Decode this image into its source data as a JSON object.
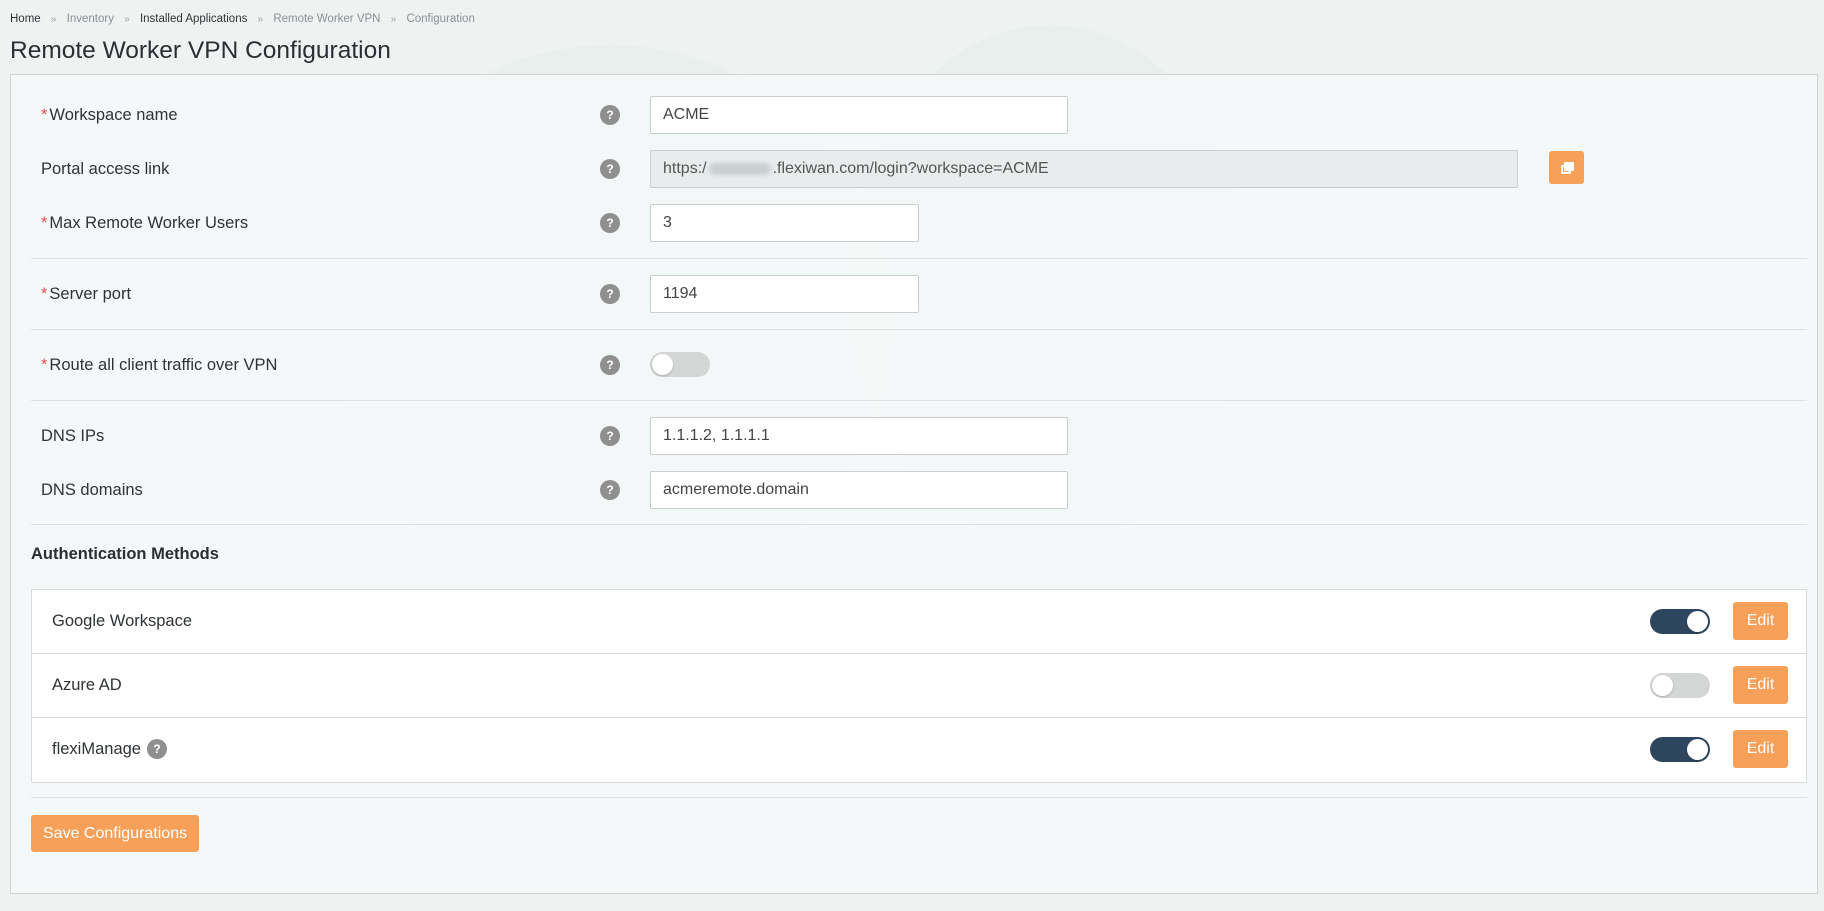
{
  "breadcrumb": {
    "items": [
      "Home",
      "Inventory",
      "Installed Applications",
      "Remote Worker VPN",
      "Configuration"
    ],
    "separator": "»"
  },
  "page": {
    "title": "Remote Worker VPN Configuration"
  },
  "form": {
    "help_glyph": "?",
    "required_mark": "*",
    "workspace_name": {
      "label": "Workspace name",
      "value": "ACME"
    },
    "portal_access_link": {
      "label": "Portal access link",
      "value_prefix": "https:/",
      "value_suffix": ".flexiwan.com/login?workspace=ACME"
    },
    "max_users": {
      "label": "Max Remote Worker Users",
      "value": "3"
    },
    "server_port": {
      "label": "Server port",
      "value": "1194"
    },
    "route_all_traffic": {
      "label": "Route all client traffic over VPN",
      "enabled": false
    },
    "dns_ips": {
      "label": "DNS IPs",
      "value": "1.1.1.2, 1.1.1.1"
    },
    "dns_domains": {
      "label": "DNS domains",
      "value": "acmeremote.domain"
    }
  },
  "auth": {
    "title": "Authentication Methods",
    "edit_label": "Edit",
    "methods": [
      {
        "label": "Google Workspace",
        "enabled": true
      },
      {
        "label": "Azure AD",
        "enabled": false
      },
      {
        "label": "flexiManage",
        "enabled": true,
        "has_help": true
      }
    ]
  },
  "actions": {
    "save_label": "Save Configurations"
  },
  "colors": {
    "accent": "#f7a05a",
    "toggle_on": "#2e4560",
    "toggle_off": "#d4d6d6",
    "required": "#e25050"
  },
  "icons": {
    "help": "question-circle-icon",
    "copy": "copy-icon"
  }
}
